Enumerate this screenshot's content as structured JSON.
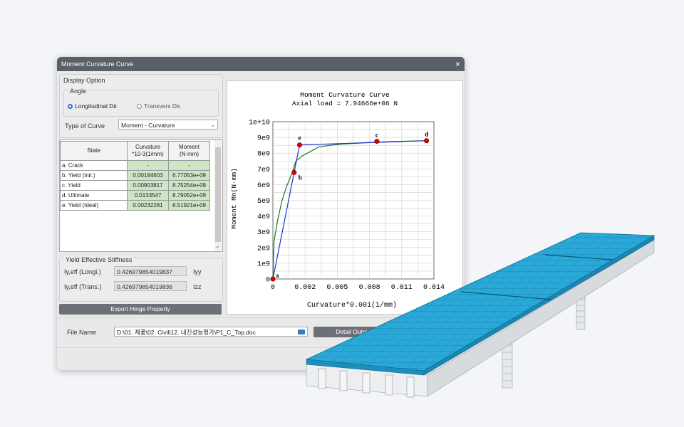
{
  "dialog": {
    "title": "Moment Curvature Curve",
    "close_icon": "×"
  },
  "display_option": {
    "label": "Display Option",
    "angle_label": "Angle",
    "radio_longitudinal": "Longitudinal Dir.",
    "radio_transvers": "Transvers Dir.",
    "selected": "longitudinal",
    "type_of_curve_label": "Type of Curve",
    "type_of_curve_value": "Moment - Curvature"
  },
  "table": {
    "headers": {
      "state": "State",
      "curvature_1": "Curvature",
      "curvature_2": "*10-3(1/mm)",
      "moment_1": "Moment",
      "moment_2": "(N·mm)"
    },
    "rows": [
      {
        "state": "a. Crack",
        "curvature": "-",
        "moment": "-"
      },
      {
        "state": "b. Yield (Init.)",
        "curvature": "0.00184603",
        "moment": "6.77053e+09"
      },
      {
        "state": "c. Yield",
        "curvature": "0.00903817",
        "moment": "8.75254e+09"
      },
      {
        "state": "d. Ultimate",
        "curvature": "0.0133547",
        "moment": "8.79052e+09"
      },
      {
        "state": "e. Yield (Ideal)",
        "curvature": "0.00232281",
        "moment": "8.51921e+09"
      }
    ]
  },
  "stiffness": {
    "label": "Yield Effective Stiffness",
    "longi_label": "Iy,eff (Longi.)",
    "longi_value": "0.426979854019837",
    "longi_unit": "Iyy",
    "trans_label": "Iy,eff (Trans.)",
    "trans_value": "0.426979854019836",
    "trans_unit": "Izz"
  },
  "export_button": "Export Hinge Property",
  "file": {
    "label": "File Name",
    "value": "D:\\01. 제품\\02. Civil\\12. 내진성능평가\\P1_C_Top.doc",
    "folder_icon": "folder-icon",
    "detail_button": "Detail Output"
  },
  "chart_data": {
    "type": "line",
    "title": "Moment Curvature Curve",
    "subtitle": "Axial load = 7.94666e+06 N",
    "xlabel": "Curvature*0.001(1/mm)",
    "ylabel": "Moment Mn(N·mm)",
    "xlim": [
      0,
      0.014
    ],
    "ylim": [
      0,
      10000000000
    ],
    "xticks": [
      "0",
      "0.002",
      "0.005",
      "0.008",
      "0.011",
      "0.014"
    ],
    "yticks": [
      "0",
      "1e9",
      "2e9",
      "3e9",
      "4e9",
      "5e9",
      "6e9",
      "7e9",
      "8e9",
      "9e9",
      "1e+10"
    ],
    "grid": true,
    "series": [
      {
        "color": "#1a7a1a",
        "x": [
          0,
          0.0001,
          0.0004,
          0.0008,
          0.0012,
          0.0016,
          0.002,
          0.0025,
          0.003,
          0.0035,
          0.004,
          0.005,
          0.006,
          0.007,
          0.008,
          0.009,
          0.01,
          0.011,
          0.012,
          0.0133547
        ],
        "y": [
          0,
          2400000000,
          3700000000,
          5000000000,
          5900000000,
          6600000000,
          7500000000,
          7800000000,
          8000000000,
          8200000000,
          8400000000,
          8500000000,
          8580000000,
          8620000000,
          8660000000,
          8700000000,
          8730000000,
          8750000000,
          8770000000,
          8790520000
        ]
      },
      {
        "color": "#1f2fd6",
        "x": [
          0,
          0.00184603,
          0.00232281,
          0.0133547
        ],
        "y": [
          0,
          6770530000,
          8519210000,
          8790520000
        ]
      }
    ],
    "points": [
      {
        "label": "a",
        "x": 0,
        "y": 0
      },
      {
        "label": "b",
        "x": 0.00184603,
        "y": 6770530000
      },
      {
        "label": "c",
        "x": 0.00903817,
        "y": 8752540000
      },
      {
        "label": "d",
        "x": 0.0133547,
        "y": 8790520000
      },
      {
        "label": "e",
        "x": 0.00232281,
        "y": 8519210000
      }
    ],
    "point_color": "#e00000"
  }
}
